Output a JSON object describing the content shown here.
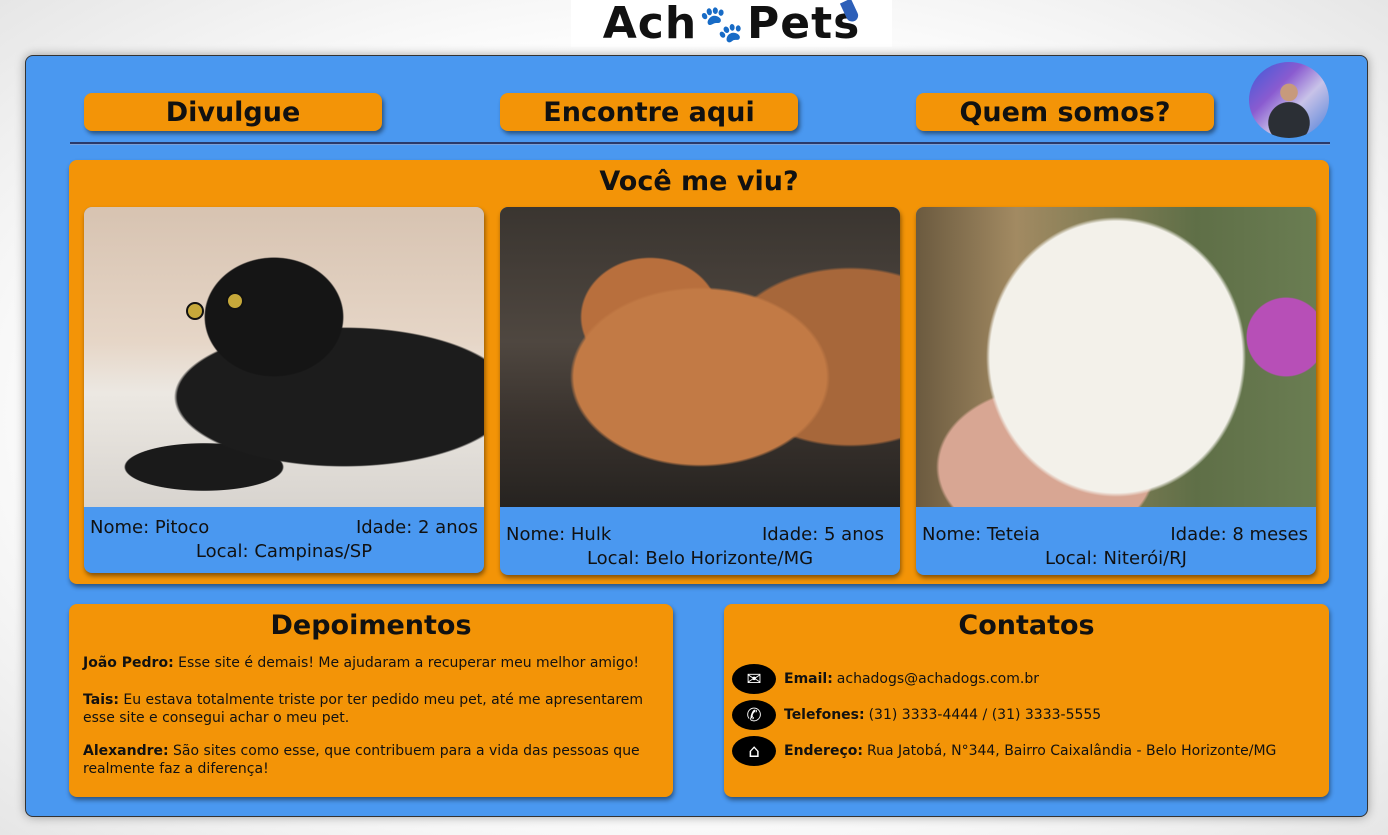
{
  "logo": {
    "text_a": "Ach",
    "text_b": "Pets",
    "paw_icon": "paw-icon"
  },
  "nav": {
    "items": [
      {
        "label": "Divulgue"
      },
      {
        "label": "Encontre aqui"
      },
      {
        "label": "Quem somos?"
      }
    ]
  },
  "seen": {
    "title": "Você me viu?",
    "pets": [
      {
        "name": "Nome: Pitoco",
        "age": "Idade: 2 anos",
        "location": "Local: Campinas/SP",
        "photo": "black-cat-photo"
      },
      {
        "name": "Nome: Hulk",
        "age": "Idade: 5 anos",
        "location": "Local: Belo Horizonte/MG",
        "photo": "brown-dog-photo"
      },
      {
        "name": "Nome: Teteia",
        "age": "Idade: 8 meses",
        "location": "Local: Niterói/RJ",
        "photo": "white-cockatoo-photo"
      }
    ]
  },
  "testimonials": {
    "title": "Depoimentos",
    "items": [
      {
        "author": "João Pedro:",
        "text": "Esse site é demais! Me ajudaram a recuperar meu melhor amigo!"
      },
      {
        "author": "Tais:",
        "text": "Eu estava totalmente triste por ter pedido meu pet, até me apresentarem esse site e consegui achar o meu pet."
      },
      {
        "author": "Alexandre:",
        "text": "São sites como esse, que contribuem para a vida das pessoas que realmente faz a diferença!"
      }
    ]
  },
  "contacts": {
    "title": "Contatos",
    "items": [
      {
        "label": "Email:",
        "value": "achadogs@achadogs.com.br",
        "icon": "envelope-icon"
      },
      {
        "label": "Telefones:",
        "value": "(31) 3333-4444 / (31) 3333-5555",
        "icon": "phone-icon"
      },
      {
        "label": "Endereço:",
        "value": "Rua Jatobá, N°344, Bairro Caixalândia - Belo Horizonte/MG",
        "icon": "home-icon"
      }
    ]
  },
  "colors": {
    "accent": "#f39407",
    "background": "#4a98f0"
  }
}
